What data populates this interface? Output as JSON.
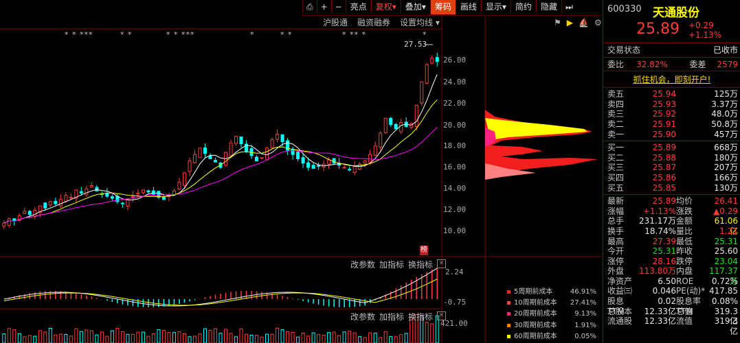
{
  "toolbar": {
    "items": [
      "亮点",
      "复权",
      "叠加",
      "筹码",
      "画线",
      "显示",
      "简约",
      "隐藏"
    ],
    "icons": [
      "page-icon",
      "plus-icon",
      "minus-icon"
    ]
  },
  "subbar": [
    "沪股通",
    "融资融券",
    "设置均线"
  ],
  "stars": [
    "*  *  ***",
    "*  *",
    "*  *  ***",
    "*",
    "*  *",
    "*  **  *",
    "*"
  ],
  "max_label": "27.53",
  "y_axis": [
    "26.00",
    "24.00",
    "22.00",
    "20.00",
    "18.00",
    "16.00",
    "14.00",
    "12.00",
    "10.00"
  ],
  "bang": "榜",
  "sub1": {
    "params": "改参数",
    "add": "加指标",
    "switch": "换指标",
    "top": "2.24",
    "bottom": "-0.75"
  },
  "sub2": {
    "params": "改参数",
    "add": "加指标",
    "switch": "换指标",
    "top": "421.00"
  },
  "cost_legend": [
    {
      "label": "5周期前成本",
      "value": "46.91%",
      "color": "#ff2020"
    },
    {
      "label": "10周期前成本",
      "value": "27.41%",
      "color": "#ff4040"
    },
    {
      "label": "20周期前成本",
      "value": "9.13%",
      "color": "#ff2080"
    },
    {
      "label": "30周期前成本",
      "value": "1.91%",
      "color": "#ff8000"
    },
    {
      "label": "60周期前成本",
      "value": "0.05%",
      "color": "#ffff00"
    }
  ],
  "quote": {
    "code": "600330",
    "name": "天通股份",
    "price": "25.89",
    "change": "+0.29",
    "change_pct": "+1.13%",
    "status_label": "交易状态",
    "status": "已收市",
    "wb_label": "委比",
    "wb": "32.82%",
    "wc_label": "委差",
    "wc": "2579",
    "promo": "抓住机会，即刻开户!",
    "asks": [
      [
        "卖五",
        "25.94",
        "125万"
      ],
      [
        "卖四",
        "25.93",
        "3.37万"
      ],
      [
        "卖三",
        "25.92",
        "48.0万"
      ],
      [
        "卖二",
        "25.91",
        "50.8万"
      ],
      [
        "卖一",
        "25.90",
        "457万"
      ]
    ],
    "bids": [
      [
        "买一",
        "25.89",
        "668万"
      ],
      [
        "买二",
        "25.88",
        "180万"
      ],
      [
        "买三",
        "25.87",
        "207万"
      ],
      [
        "买四",
        "25.86",
        "166万"
      ],
      [
        "买五",
        "25.85",
        "130万"
      ]
    ],
    "stats": [
      [
        "最新",
        "25.89",
        "red",
        "均价",
        "26.41",
        "red"
      ],
      [
        "涨幅",
        "+1.13%",
        "red",
        "涨跌",
        "▲0.29",
        "red"
      ],
      [
        "总手",
        "231.17万",
        "white",
        "金额",
        "61.06亿",
        "yellow"
      ],
      [
        "换手",
        "18.74%",
        "white",
        "量比",
        "1.21",
        "red"
      ],
      [
        "最高",
        "27.39",
        "red",
        "最低",
        "25.31",
        "green"
      ],
      [
        "今开",
        "25.31",
        "green",
        "昨收",
        "25.60",
        "white"
      ],
      [
        "涨停",
        "28.16",
        "red",
        "跌停",
        "23.04",
        "green"
      ],
      [
        "外盘",
        "113.80万",
        "red",
        "内盘",
        "117.37万",
        "green"
      ],
      [
        "净资产",
        "6.50",
        "white",
        "ROE",
        "0.72%",
        "white"
      ],
      [
        "收益㈢",
        "0.046",
        "white",
        "PE(动)*",
        "417.85",
        "white"
      ],
      [
        "股息TTM",
        "0.02",
        "white",
        "股息率TTM",
        "0.08%",
        "white"
      ],
      [
        "总股本",
        "12.33亿",
        "white",
        "总值",
        "319.3亿",
        "white"
      ],
      [
        "流通股",
        "12.33亿",
        "white",
        "流值",
        "319.3亿",
        "white"
      ]
    ]
  },
  "colors": {
    "up": "#ff3b3b",
    "down": "#00ffff",
    "ma5": "#ffffff",
    "ma10": "#ffff00",
    "ma20": "#ff00ff"
  }
}
